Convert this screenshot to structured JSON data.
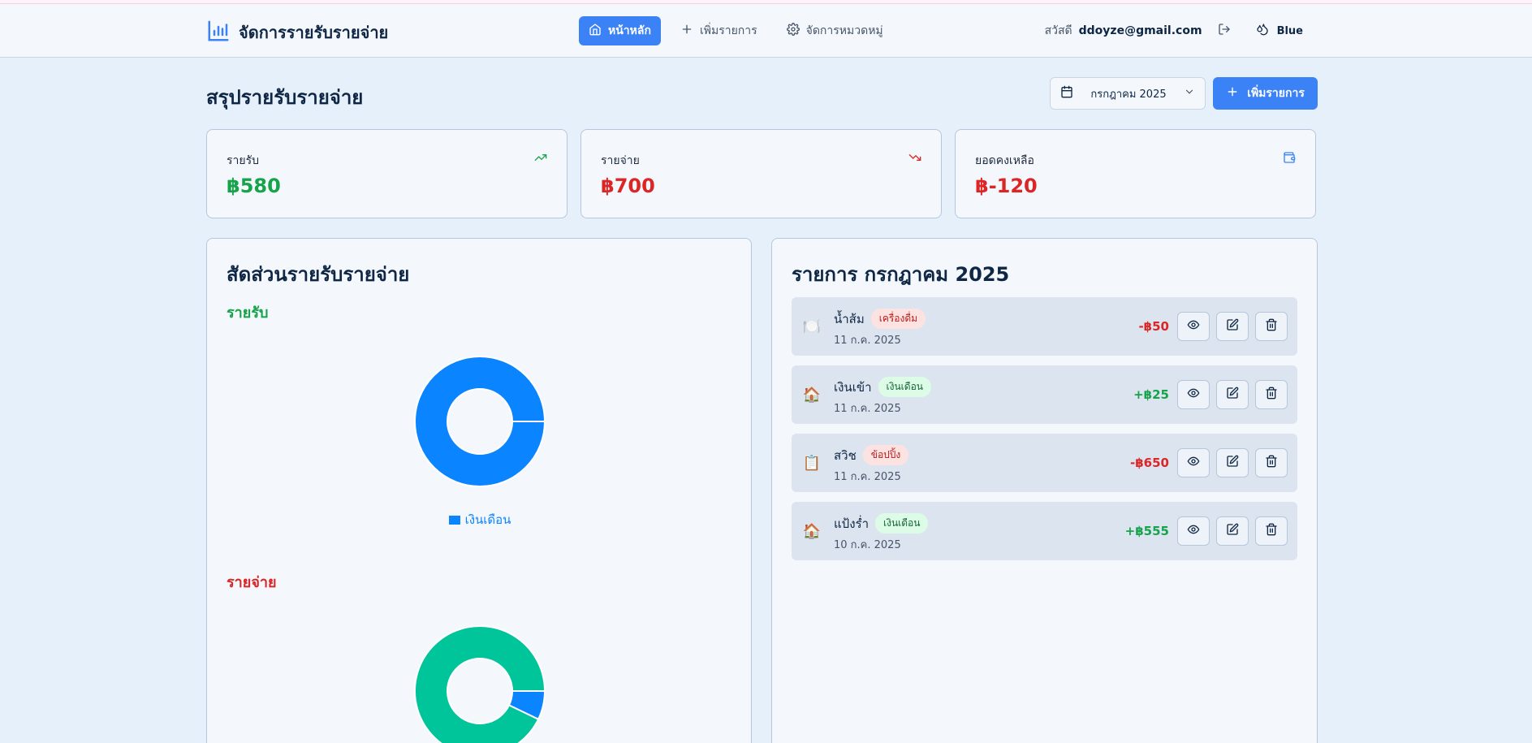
{
  "nav": {
    "app_title": "จัดการรายรับรายจ่าย",
    "links": [
      {
        "label": "หน้าหลัก",
        "icon": "home-icon",
        "active": true
      },
      {
        "label": "เพิ่มรายการ",
        "icon": "plus-icon",
        "active": false
      },
      {
        "label": "จัดการหมวดหมู่",
        "icon": "gear-icon",
        "active": false
      }
    ],
    "greeting": "สวัสดี",
    "email": "ddoyze@gmail.com",
    "theme_label": "Blue"
  },
  "header": {
    "title": "สรุปรายรับรายจ่าย",
    "month_value": "กรกฎาคม 2025",
    "add_button_label": "เพิ่มรายการ"
  },
  "summary": {
    "income": {
      "label": "รายรับ",
      "value": "฿580",
      "color": "#16a34a",
      "icon": "trending-up-icon"
    },
    "expense": {
      "label": "รายจ่าย",
      "value": "฿700",
      "color": "#dc2626",
      "icon": "trending-down-icon"
    },
    "balance": {
      "label": "ยอดคงเหลือ",
      "value": "฿-120",
      "color": "#dc2626",
      "icon": "wallet-icon"
    }
  },
  "ratio_panel": {
    "title": "สัดส่วนรายรับรายจ่าย",
    "income_label": "รายรับ",
    "expense_label": "รายจ่าย",
    "income_legend": "เงินเดือน"
  },
  "chart_data": [
    {
      "type": "pie",
      "title": "รายรับ",
      "slices": [
        {
          "label": "เงินเดือน",
          "value": 580,
          "color": "#0b84ff"
        }
      ]
    },
    {
      "type": "pie",
      "title": "รายจ่าย",
      "slices": [
        {
          "label": "ข้อปปิ้ง",
          "value": 650,
          "color": "#00c49a"
        },
        {
          "label": "เครื่องดื่ม",
          "value": 50,
          "color": "#0b84ff"
        }
      ]
    }
  ],
  "transactions_panel": {
    "title": "รายการ กรกฎาคม 2025",
    "items": [
      {
        "emoji": "🍽️",
        "name": "น้ำส้ม",
        "category": "เครื่องดื่ม",
        "category_type": "expense",
        "date": "11 ก.ค. 2025",
        "amount": "-฿50",
        "amount_color": "#dc2626"
      },
      {
        "emoji": "🏠",
        "name": "เงินเข้า",
        "category": "เงินเดือน",
        "category_type": "income",
        "date": "11 ก.ค. 2025",
        "amount": "+฿25",
        "amount_color": "#16a34a"
      },
      {
        "emoji": "📋",
        "name": "สวิช",
        "category": "ข้อปปิ้ง",
        "category_type": "expense",
        "date": "11 ก.ค. 2025",
        "amount": "-฿650",
        "amount_color": "#dc2626"
      },
      {
        "emoji": "🏠",
        "name": "แป้งร่ำ",
        "category": "เงินเดือน",
        "category_type": "income",
        "date": "10 ก.ค. 2025",
        "amount": "+฿555",
        "amount_color": "#16a34a"
      }
    ]
  }
}
